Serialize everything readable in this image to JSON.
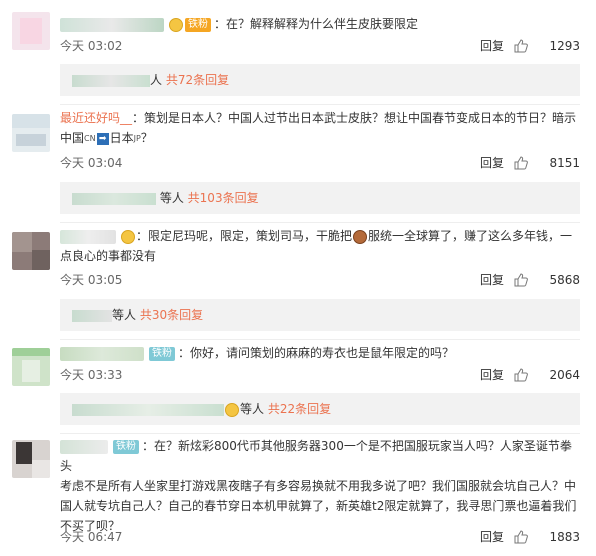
{
  "comments": [
    {
      "username": "",
      "badge": "铁粉",
      "text": "在？解释解释为什么伴生皮肤要限定",
      "time": "今天 03:02",
      "reply_label": "回复",
      "likes": "1293",
      "sub_text": "人",
      "sub_more": "共72条回复"
    },
    {
      "username": "最近还好吗__",
      "text_1": "策划是日本人？中国人过节出日本武士皮肤？想让中国春节变成日本的节日？暗示",
      "text_2a": "中国",
      "flag_cn": "CN",
      "arrow": "➡",
      "text_2b": "日本",
      "flag_jp": "JP",
      "text_2c": "？",
      "time": "今天 03:04",
      "reply_label": "回复",
      "likes": "8151",
      "sub_text": "等人",
      "sub_more": "共103条回复"
    },
    {
      "username": "",
      "text_1a": "限定尼玛呢，限定，策划司马，干脆把",
      "text_1b": "服统一全球算了，赚了这么多年钱，一",
      "text_2": "点良心的事都没有",
      "time": "今天 03:05",
      "reply_label": "回复",
      "likes": "5868",
      "sub_text": "等人",
      "sub_more": "共30条回复"
    },
    {
      "username": "",
      "badge": "铁粉",
      "text": "你好，请问策划的麻麻的寿衣也是鼠年限定的吗？",
      "time": "今天 03:33",
      "reply_label": "回复",
      "likes": "2064",
      "sub_text": "等人",
      "sub_more": "共22条回复"
    },
    {
      "username": "",
      "badge": "铁粉",
      "text_1": "在？新炫彩800代币其他服务器300一个是不把国服玩家当人吗？人家圣诞节拳头",
      "text_2": "考虑不是所有人坐家里打游戏黑夜瞎子有多容易换就不用我多说了吧？我们国服就会坑自己人？中",
      "text_3": "国人就专坑自己人？自己的春节穿日本机甲就算了，新英雄t2限定就算了，我寻思门票也逼着我们",
      "text_4": "不买了呗？",
      "time": "今天 06:47",
      "reply_label": "回复",
      "likes": "1883"
    }
  ],
  "colors": {
    "username": "#eb7350",
    "iron_fan_badge": "#7fc9d6",
    "gold_fan_badge": "#f5a623",
    "sub_bg": "#f2f2f2",
    "more_link": "#eb7350"
  },
  "icons": {
    "like": "thumbs-up-icon",
    "fan_emoji": "face-emoji-icon",
    "flag_arrow": "blue-arrow-icon"
  }
}
